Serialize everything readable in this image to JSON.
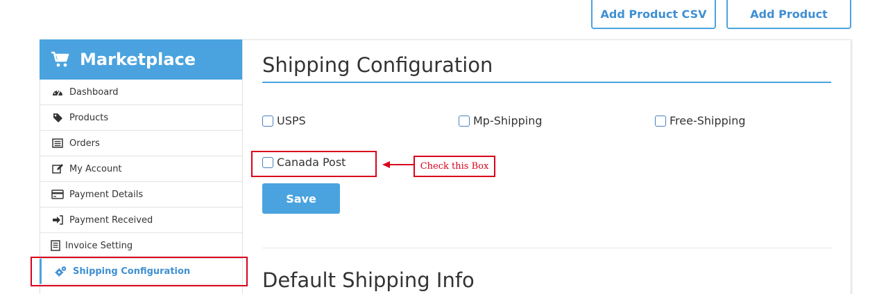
{
  "top_buttons": {
    "csv_label": "Add Product CSV",
    "add_label": "Add Product"
  },
  "sidebar": {
    "title": "Marketplace",
    "items": [
      {
        "label": "Dashboard",
        "icon": "dashboard-icon"
      },
      {
        "label": "Products",
        "icon": "tag-icon"
      },
      {
        "label": "Orders",
        "icon": "list-icon"
      },
      {
        "label": "My Account",
        "icon": "edit-icon"
      },
      {
        "label": "Payment Details",
        "icon": "credit-card-icon"
      },
      {
        "label": "Payment Received",
        "icon": "sign-in-icon"
      },
      {
        "label": "Invoice Setting",
        "icon": "invoice-icon"
      },
      {
        "label": "Shipping Configuration",
        "icon": "gears-icon",
        "active": true
      }
    ]
  },
  "main": {
    "title": "Shipping Configuration",
    "options": [
      {
        "label": "USPS",
        "checked": false
      },
      {
        "label": "Mp-Shipping",
        "checked": false
      },
      {
        "label": "Free-Shipping",
        "checked": false
      },
      {
        "label": "Canada Post",
        "checked": false
      }
    ],
    "save_label": "Save",
    "subtitle": "Default Shipping Info"
  },
  "annotation": {
    "note": "Check this Box",
    "color": "#d9001b"
  },
  "colors": {
    "accent": "#4aa3df",
    "accent_text": "#3f8fd2"
  }
}
